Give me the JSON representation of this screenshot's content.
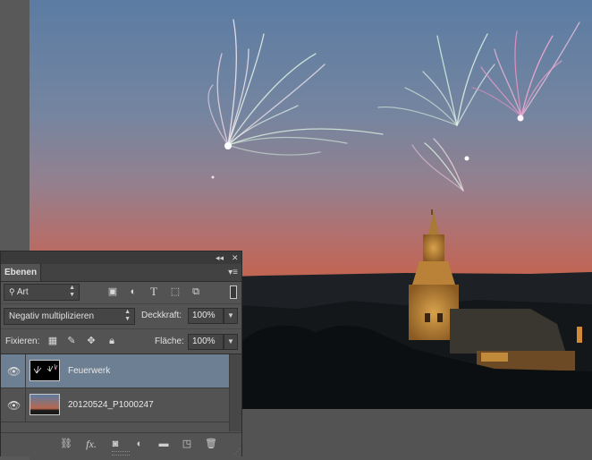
{
  "panel": {
    "collapse_glyph": "◂◂",
    "close_glyph": "✕",
    "tab_label": "Ebenen",
    "menu_glyph": "▾≡",
    "filter": {
      "selected": "Art",
      "icons": [
        "image-filter-icon",
        "adjustment-filter-icon",
        "type-filter-icon",
        "shape-filter-icon",
        "smart-object-filter-icon"
      ]
    },
    "blend_mode": "Negativ multiplizieren",
    "opacity_label": "Deckkraft:",
    "opacity_value": "100%",
    "lock_label": "Fixieren:",
    "fill_label": "Fläche:",
    "fill_value": "100%",
    "layers": [
      {
        "name": "Feuerwerk",
        "selected": true,
        "visible": true
      },
      {
        "name": "20120524_P1000247",
        "selected": false,
        "visible": true
      }
    ],
    "footer_icons": [
      "link-layers-icon",
      "fx-icon",
      "add-mask-icon",
      "adjustment-layer-icon",
      "new-group-icon",
      "new-layer-icon",
      "delete-layer-icon"
    ]
  },
  "colors": {
    "panel_bg": "#535353",
    "selected_layer": "#6d7f93",
    "sky_top": "#5d7da2",
    "sky_bottom": "#c4624c"
  }
}
